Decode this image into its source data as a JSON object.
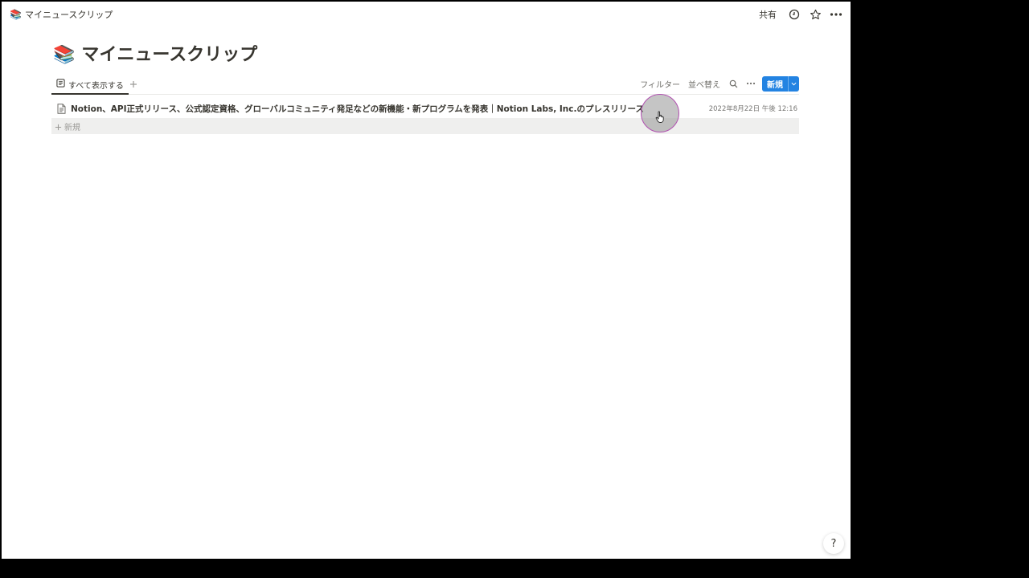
{
  "topbar": {
    "breadcrumb_icon": "📚",
    "breadcrumb_title": "マイニュースクリップ",
    "share_label": "共有",
    "icons": [
      "clock-icon",
      "star-icon",
      "more-icon"
    ]
  },
  "page": {
    "icon": "📚",
    "title": "マイニュースクリップ"
  },
  "view": {
    "tab_label": "すべて表示する",
    "filter_label": "フィルター",
    "sort_label": "並べ替え",
    "new_button_label": "新規"
  },
  "list": {
    "rows": [
      {
        "title": "Notion、API正式リリース、公式認定資格、グローバルコミュニティ発足などの新機能・新プログラムを発表｜Notion Labs, Inc.のプレスリリース",
        "date": "2022年8月22日 午後 12:16"
      }
    ],
    "new_row_label": "新規"
  },
  "help": {
    "label": "?"
  },
  "colors": {
    "accent": "#2383e2",
    "text": "#37352f",
    "muted": "#787774",
    "background": "#ffffff",
    "outer": "#000000"
  }
}
